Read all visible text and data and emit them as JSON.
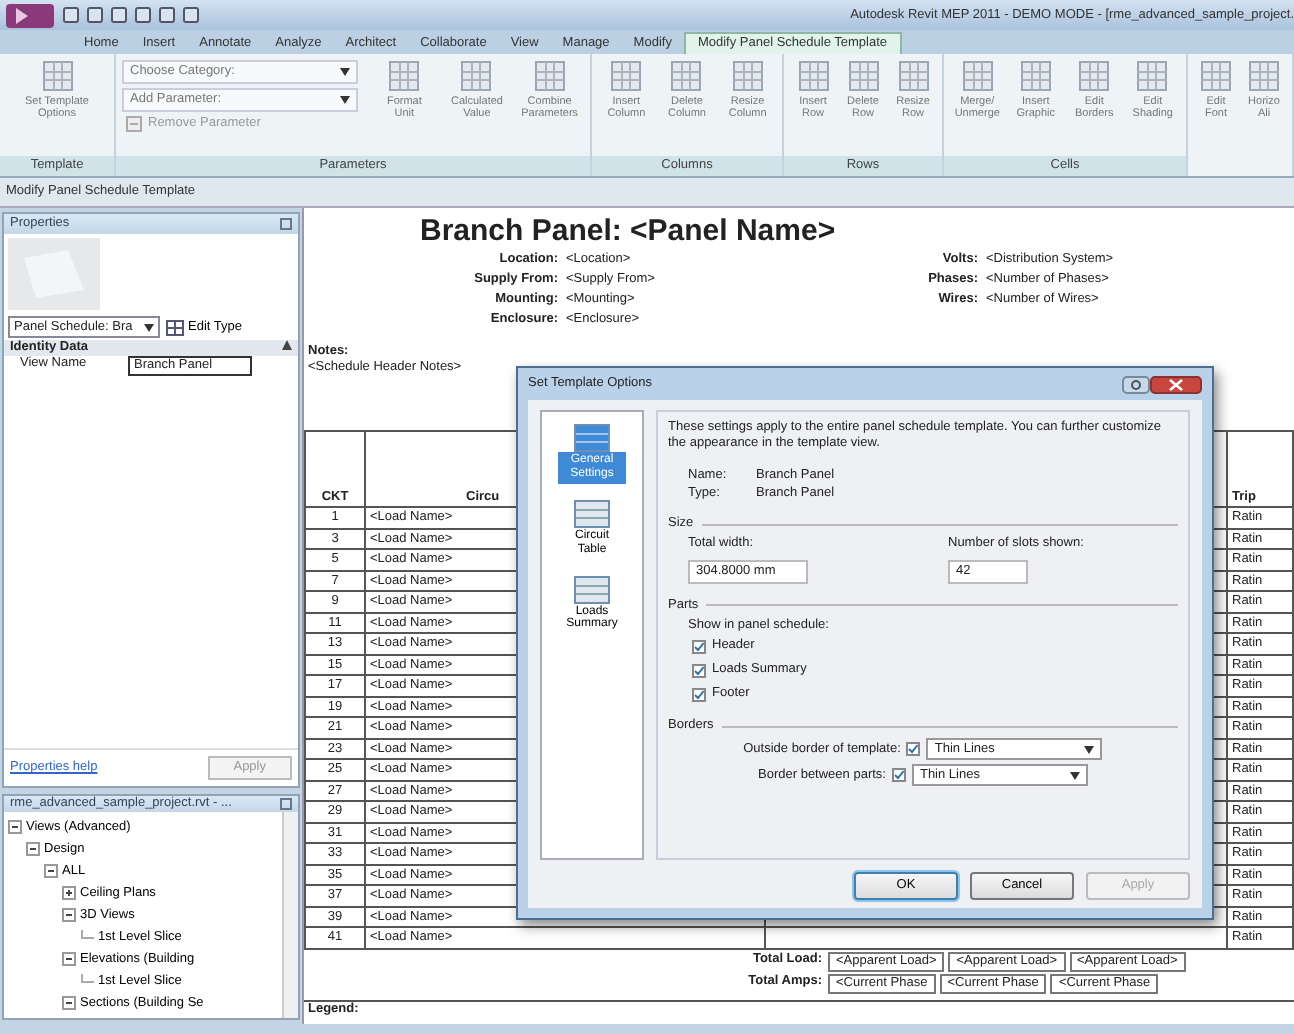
{
  "window": {
    "title": "Autodesk Revit MEP 2011 - DEMO MODE - [rme_advanced_sample_project."
  },
  "ribbon": {
    "tabs": [
      {
        "label": "Home",
        "selected": false
      },
      {
        "label": "Insert",
        "selected": false
      },
      {
        "label": "Annotate",
        "selected": false
      },
      {
        "label": "Analyze",
        "selected": false
      },
      {
        "label": "Architect",
        "selected": false
      },
      {
        "label": "Collaborate",
        "selected": false
      },
      {
        "label": "View",
        "selected": false
      },
      {
        "label": "Manage",
        "selected": false
      },
      {
        "label": "Modify",
        "selected": false
      },
      {
        "label": "Modify Panel Schedule Template",
        "selected": true
      }
    ],
    "panels": [
      {
        "label": "Template",
        "items": [
          {
            "kind": "large",
            "lines": [
              "Set Template",
              "Options"
            ]
          }
        ]
      },
      {
        "label": "Parameters",
        "items": [
          {
            "kind": "stack",
            "fields": [
              "Choose Category:",
              "Add Parameter:"
            ],
            "small": "Remove Parameter"
          },
          {
            "kind": "large",
            "lines": [
              "Format",
              "Unit"
            ]
          },
          {
            "kind": "large",
            "lines": [
              "Calculated",
              "Value"
            ]
          },
          {
            "kind": "large",
            "lines": [
              "Combine",
              "Parameters"
            ]
          }
        ]
      },
      {
        "label": "Columns",
        "items": [
          {
            "kind": "large",
            "lines": [
              "Insert",
              "Column"
            ]
          },
          {
            "kind": "large",
            "lines": [
              "Delete",
              "Column"
            ]
          },
          {
            "kind": "large",
            "lines": [
              "Resize",
              "Column"
            ]
          }
        ]
      },
      {
        "label": "Rows",
        "items": [
          {
            "kind": "large",
            "lines": [
              "Insert",
              "Row"
            ]
          },
          {
            "kind": "large",
            "lines": [
              "Delete",
              "Row"
            ]
          },
          {
            "kind": "large",
            "lines": [
              "Resize",
              "Row"
            ]
          }
        ]
      },
      {
        "label": "Cells",
        "items": [
          {
            "kind": "large",
            "lines": [
              "Merge/",
              "Unmerge"
            ]
          },
          {
            "kind": "large",
            "lines": [
              "Insert",
              "Graphic"
            ]
          },
          {
            "kind": "large",
            "lines": [
              "Edit",
              "Borders"
            ]
          },
          {
            "kind": "large",
            "lines": [
              "Edit",
              "Shading"
            ]
          }
        ]
      },
      {
        "items": [
          {
            "kind": "large",
            "lines": [
              "Edit",
              "Font"
            ]
          },
          {
            "kind": "large",
            "lines": [
              "Horizo",
              "Ali"
            ]
          }
        ]
      }
    ]
  },
  "context_bar": "Modify Panel Schedule Template",
  "properties": {
    "title": "Properties",
    "type_selector": "Panel Schedule: Bra",
    "edit_type": "Edit Type",
    "group": "Identity Data",
    "rows": [
      {
        "name": "View Name",
        "value": "Branch Panel"
      }
    ],
    "help_link": "Properties help",
    "apply": "Apply"
  },
  "project_browser": {
    "title": "rme_advanced_sample_project.rvt - ...",
    "tree": [
      {
        "label": "Views (Advanced)",
        "expanded": true,
        "children": [
          {
            "label": "Design",
            "expanded": true,
            "children": [
              {
                "label": "ALL",
                "expanded": true,
                "children": [
                  {
                    "label": "Ceiling Plans",
                    "expanded": false
                  },
                  {
                    "label": "3D Views",
                    "expanded": true,
                    "children": [
                      {
                        "label": "1st Level Slice"
                      }
                    ]
                  },
                  {
                    "label": "Elevations (Building",
                    "expanded": true,
                    "children": [
                      {
                        "label": "1st Level Slice"
                      }
                    ]
                  },
                  {
                    "label": "Sections (Building Se",
                    "expanded": true
                  }
                ]
              }
            ]
          }
        ]
      }
    ]
  },
  "schedule": {
    "title": "Branch Panel: <Panel Name>",
    "info_left": [
      {
        "label": "Location:",
        "value": "<Location>"
      },
      {
        "label": "Supply From:",
        "value": "<Supply From>"
      },
      {
        "label": "Mounting:",
        "value": "<Mounting>"
      },
      {
        "label": "Enclosure:",
        "value": "<Enclosure>"
      }
    ],
    "info_right": [
      {
        "label": "Volts:",
        "value": "<Distribution System>"
      },
      {
        "label": "Phases:",
        "value": "<Number of Phases>"
      },
      {
        "label": "Wires:",
        "value": "<Number of Wires>"
      }
    ],
    "notes_label": "Notes:",
    "notes": "<Schedule Header Notes>",
    "columns": [
      "CKT",
      "Circu",
      "Trip"
    ],
    "rows": [
      {
        "ckt": "1",
        "load": "<Load Name>",
        "trip": "Ratin"
      },
      {
        "ckt": "3",
        "load": "<Load Name>",
        "trip": "Ratin"
      },
      {
        "ckt": "5",
        "load": "<Load Name>",
        "trip": "Ratin"
      },
      {
        "ckt": "7",
        "load": "<Load Name>",
        "trip": "Ratin"
      },
      {
        "ckt": "9",
        "load": "<Load Name>",
        "trip": "Ratin"
      },
      {
        "ckt": "11",
        "load": "<Load Name>",
        "trip": "Ratin"
      },
      {
        "ckt": "13",
        "load": "<Load Name>",
        "trip": "Ratin"
      },
      {
        "ckt": "15",
        "load": "<Load Name>",
        "trip": "Ratin"
      },
      {
        "ckt": "17",
        "load": "<Load Name>",
        "trip": "Ratin"
      },
      {
        "ckt": "19",
        "load": "<Load Name>",
        "trip": "Ratin"
      },
      {
        "ckt": "21",
        "load": "<Load Name>",
        "trip": "Ratin"
      },
      {
        "ckt": "23",
        "load": "<Load Name>",
        "trip": "Ratin"
      },
      {
        "ckt": "25",
        "load": "<Load Name>",
        "trip": "Ratin"
      },
      {
        "ckt": "27",
        "load": "<Load Name>",
        "trip": "Ratin"
      },
      {
        "ckt": "29",
        "load": "<Load Name>",
        "trip": "Ratin"
      },
      {
        "ckt": "31",
        "load": "<Load Name>",
        "trip": "Ratin"
      },
      {
        "ckt": "33",
        "load": "<Load Name>",
        "trip": "Ratin"
      },
      {
        "ckt": "35",
        "load": "<Load Name>",
        "trip": "Ratin"
      },
      {
        "ckt": "37",
        "load": "<Load Name>",
        "trip": "Ratin"
      },
      {
        "ckt": "39",
        "load": "<Load Name>",
        "trip": "Ratin"
      },
      {
        "ckt": "41",
        "load": "<Load Name>",
        "trip": "Ratin"
      }
    ],
    "totals": [
      {
        "label": "Total Load:",
        "values": [
          "<Apparent Load>",
          "<Apparent Load>",
          "<Apparent Load>"
        ]
      },
      {
        "label": "Total Amps:",
        "values": [
          "<Current Phase",
          "<Current Phase",
          "<Current Phase"
        ]
      }
    ],
    "legend": "Legend:"
  },
  "dialog": {
    "title": "Set Template Options",
    "nav": [
      {
        "label": "General Settings",
        "selected": true
      },
      {
        "label": "Circuit Table",
        "selected": false
      },
      {
        "label": "Loads Summary",
        "selected": false
      }
    ],
    "intro": "These settings apply to the entire panel schedule template. You can further customize the appearance in the template view.",
    "name_label": "Name:",
    "name": "Branch Panel",
    "type_label": "Type:",
    "type": "Branch Panel",
    "size_section": "Size",
    "total_width_label": "Total width:",
    "total_width": "304.8000 mm",
    "slots_label": "Number of slots shown:",
    "slots": "42",
    "parts_section": "Parts",
    "parts_intro": "Show in panel schedule:",
    "parts": [
      {
        "label": "Header",
        "checked": true
      },
      {
        "label": "Loads Summary",
        "checked": true
      },
      {
        "label": "Footer",
        "checked": true
      }
    ],
    "borders_section": "Borders",
    "borders": [
      {
        "label": "Outside border of template:",
        "checked": true,
        "style": "Thin Lines"
      },
      {
        "label": "Border between parts:",
        "checked": true,
        "style": "Thin Lines"
      }
    ],
    "buttons": [
      {
        "label": "OK",
        "disabled": false,
        "default": true
      },
      {
        "label": "Cancel",
        "disabled": false,
        "default": false
      },
      {
        "label": "Apply",
        "disabled": true,
        "default": false
      }
    ]
  }
}
